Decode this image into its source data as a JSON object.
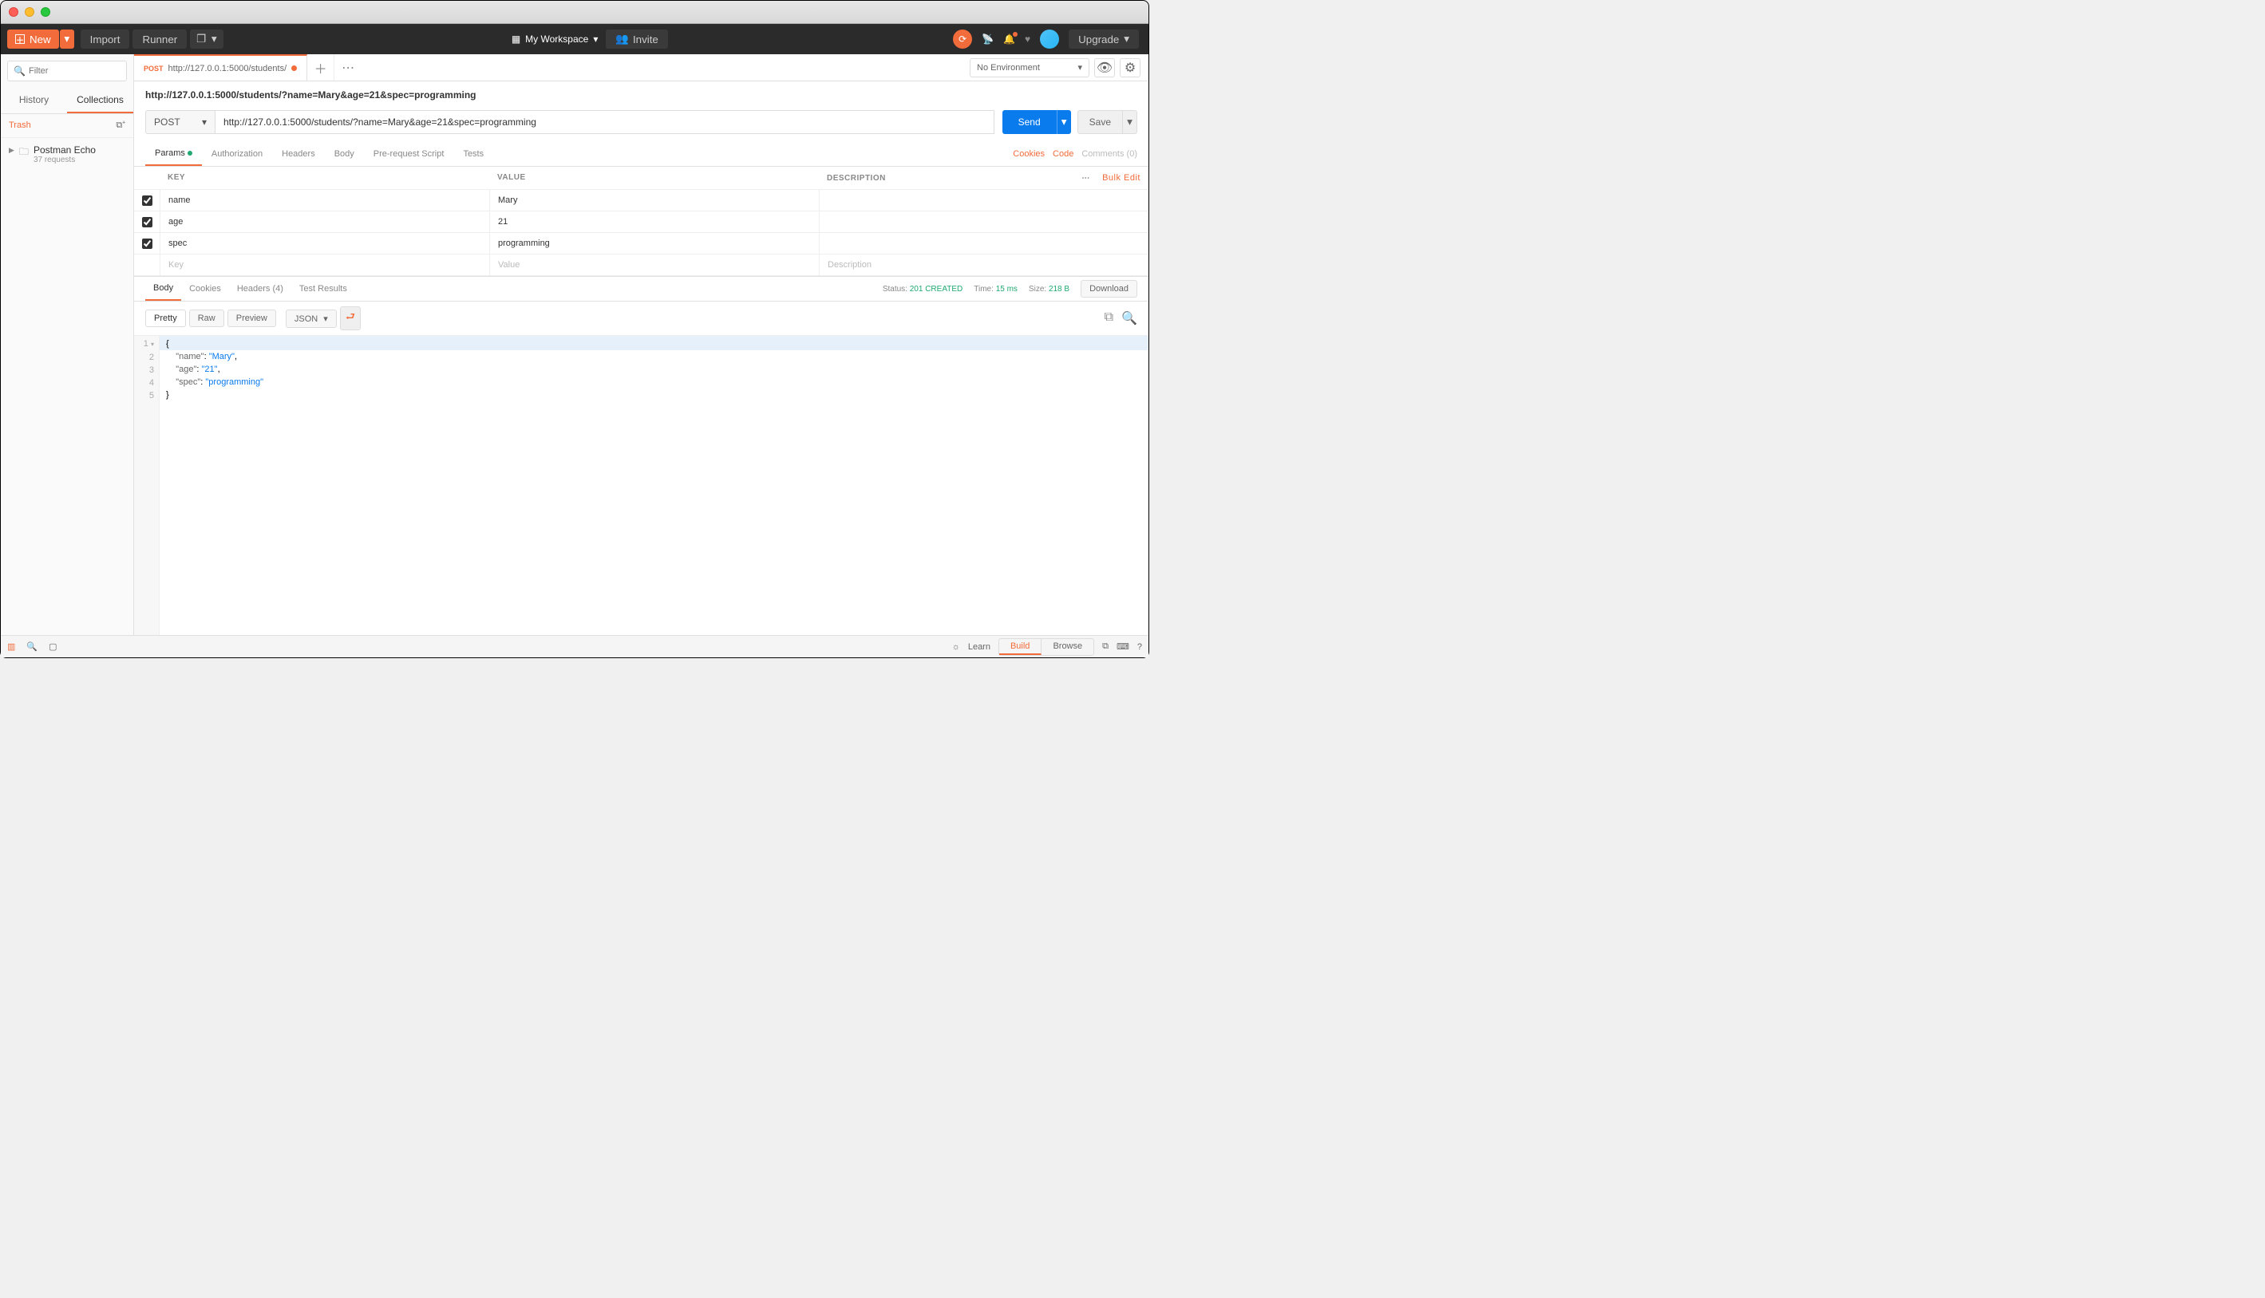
{
  "topbar": {
    "new_label": "New",
    "import_label": "Import",
    "runner_label": "Runner",
    "workspace_label": "My Workspace",
    "invite_label": "Invite",
    "upgrade_label": "Upgrade"
  },
  "sidebar": {
    "filter_placeholder": "Filter",
    "tab_history": "History",
    "tab_collections": "Collections",
    "trash_label": "Trash",
    "collection": {
      "name": "Postman Echo",
      "sub": "37 requests"
    }
  },
  "tabs": {
    "active": {
      "method": "POST",
      "url": "http://127.0.0.1:5000/students/"
    }
  },
  "env": {
    "label": "No Environment"
  },
  "request": {
    "name": "http://127.0.0.1:5000/students/?name=Mary&age=21&spec=programming",
    "method": "POST",
    "url": "http://127.0.0.1:5000/students/?name=Mary&age=21&spec=programming",
    "send_label": "Send",
    "save_label": "Save"
  },
  "req_tabs": {
    "params": "Params",
    "auth": "Authorization",
    "headers": "Headers",
    "body": "Body",
    "prereq": "Pre-request Script",
    "tests": "Tests",
    "cookies_link": "Cookies",
    "code_link": "Code",
    "comments_link": "Comments (0)"
  },
  "params_table": {
    "head_key": "KEY",
    "head_value": "VALUE",
    "head_desc": "DESCRIPTION",
    "bulk_edit": "Bulk Edit",
    "rows": [
      {
        "key": "name",
        "value": "Mary"
      },
      {
        "key": "age",
        "value": "21"
      },
      {
        "key": "spec",
        "value": "programming"
      }
    ],
    "placeholder_key": "Key",
    "placeholder_value": "Value",
    "placeholder_desc": "Description"
  },
  "resp_tabs": {
    "body": "Body",
    "cookies": "Cookies",
    "headers": "Headers",
    "headers_count": "(4)",
    "tests": "Test Results"
  },
  "resp_meta": {
    "status_label": "Status:",
    "status_value": "201 CREATED",
    "time_label": "Time:",
    "time_value": "15 ms",
    "size_label": "Size:",
    "size_value": "218 B",
    "download": "Download"
  },
  "view": {
    "pretty": "Pretty",
    "raw": "Raw",
    "preview": "Preview",
    "format": "JSON"
  },
  "response_body": {
    "l1": "{",
    "l2k": "\"name\"",
    "l2v": "\"Mary\"",
    "l3k": "\"age\"",
    "l3v": "\"21\"",
    "l4k": "\"spec\"",
    "l4v": "\"programming\"",
    "l5": "}"
  },
  "statusbar": {
    "learn": "Learn",
    "build": "Build",
    "browse": "Browse"
  }
}
